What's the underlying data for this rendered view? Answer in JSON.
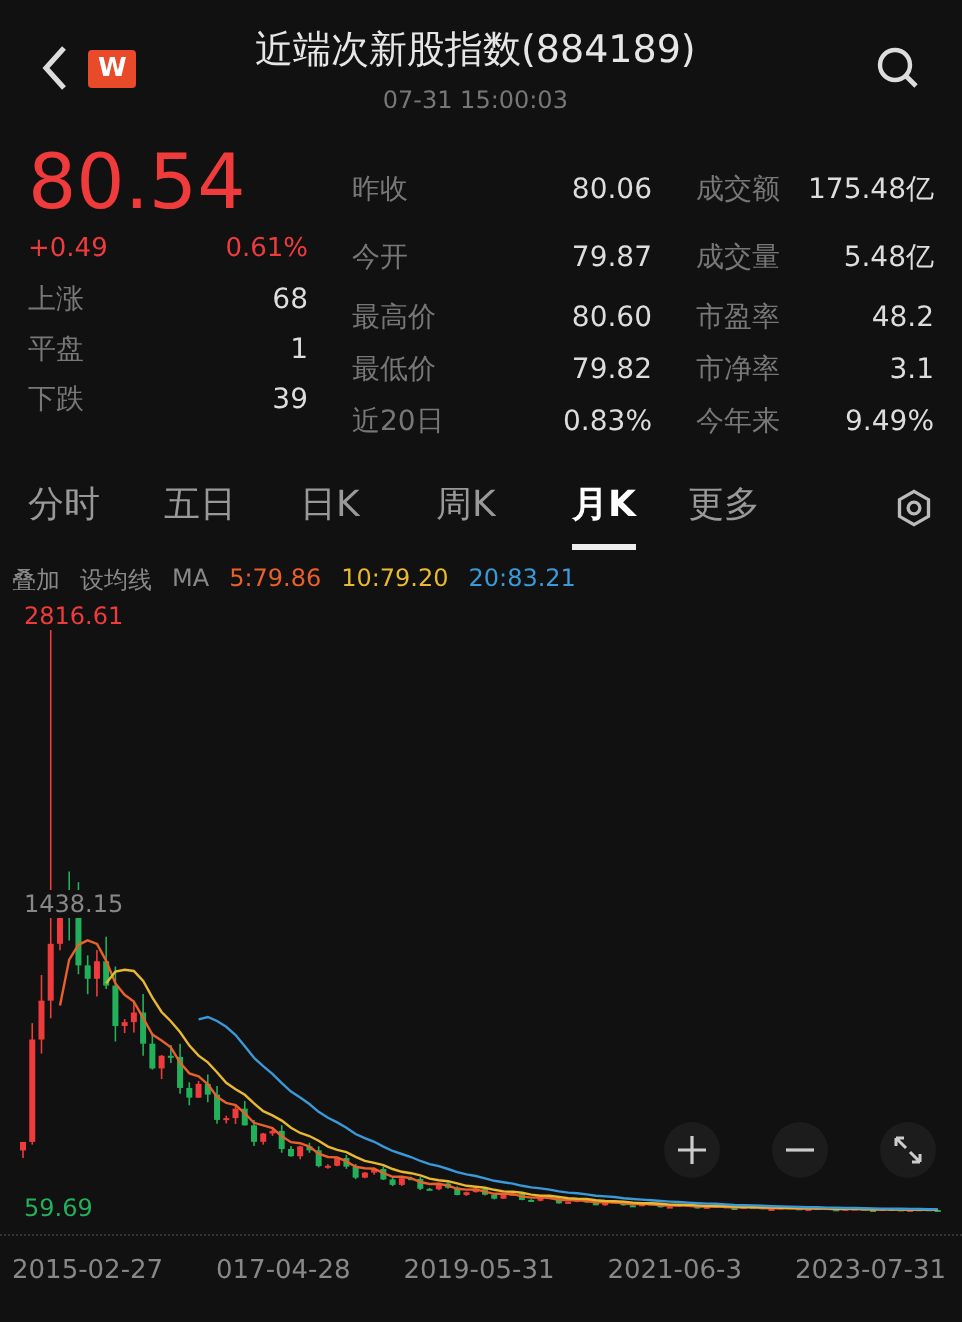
{
  "header": {
    "title": "近端次新股指数(884189)",
    "time": "07-31 15:00:03",
    "logo": "W"
  },
  "quote": {
    "price": "80.54",
    "rising": true,
    "change": "+0.49",
    "change_pct": "0.61%",
    "breadth": [
      {
        "label": "上涨",
        "value": "68"
      },
      {
        "label": "平盘",
        "value": "1"
      },
      {
        "label": "下跌",
        "value": "39"
      }
    ],
    "stats": [
      {
        "label": "昨收",
        "value": "80.06"
      },
      {
        "label": "今开",
        "value": "79.87"
      },
      {
        "label": "最高价",
        "value": "80.60"
      },
      {
        "label": "最低价",
        "value": "79.82"
      },
      {
        "label": "近20日",
        "value": "0.83%"
      }
    ],
    "stats2": [
      {
        "label": "成交额",
        "value": "175.48亿"
      },
      {
        "label": "成交量",
        "value": "5.48亿"
      },
      {
        "label": "市盈率",
        "value": "48.2"
      },
      {
        "label": "市净率",
        "value": "3.1"
      },
      {
        "label": "今年来",
        "value": "9.49%"
      }
    ]
  },
  "tabs": [
    {
      "label": "分时",
      "selected": false
    },
    {
      "label": "五日",
      "selected": false
    },
    {
      "label": "日K",
      "selected": false
    },
    {
      "label": "周K",
      "selected": false
    },
    {
      "label": "月K",
      "selected": true
    },
    {
      "label": "更多",
      "selected": false
    }
  ],
  "indicators": {
    "overlay": "叠加",
    "set_ma": "设均线",
    "ma_label": "MA",
    "ma": [
      {
        "text": "5:79.86",
        "color": "#e8602c"
      },
      {
        "text": "10:79.20",
        "color": "#e8b830"
      },
      {
        "text": "20:83.21",
        "color": "#3a9ad9"
      }
    ]
  },
  "chart": {
    "y_high": "2816.61",
    "y_mid": "1438.15",
    "y_low": "59.69",
    "x_labels": [
      "2015-02-27",
      "017-04-28",
      "2019-05-31",
      "2021-06-3",
      "2023-07-31"
    ]
  }
}
